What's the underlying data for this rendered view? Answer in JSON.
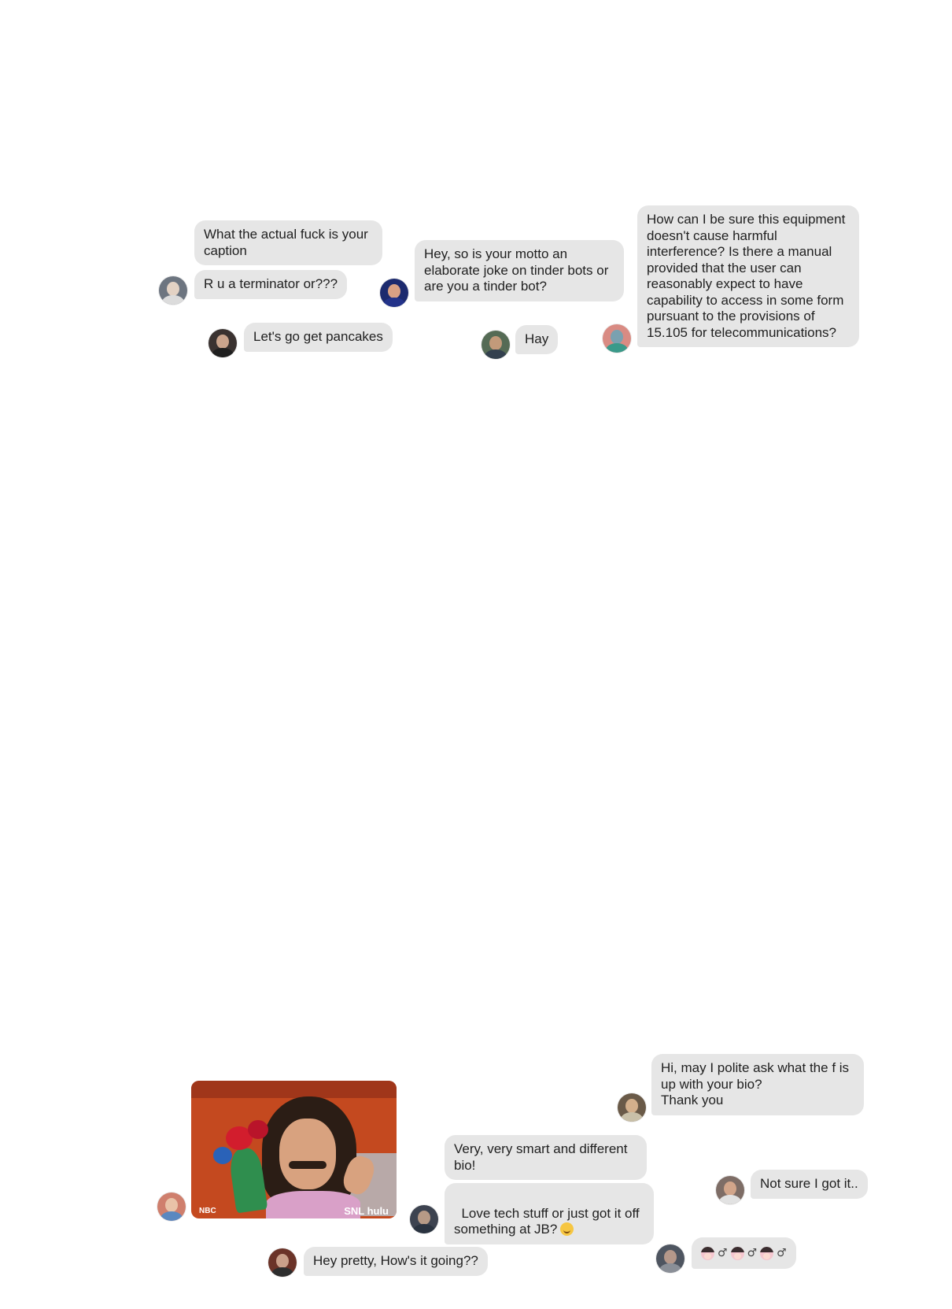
{
  "top_section": {
    "bubble_caption": "What the actual fuck is your caption",
    "bubble_terminator": "R u a terminator or???",
    "bubble_pancakes": "Let's go get pancakes",
    "bubble_motto": "Hey, so is your motto an elaborate joke on tinder bots or are you a tinder bot?",
    "bubble_hay": "Hay",
    "bubble_equipment": "How can I be sure this equipment doesn't cause harmful interference? Is there a manual provided that the user can reasonably expect to have capability to access in some form pursuant to the provisions of 15.105 for telecommunications?"
  },
  "bottom_section": {
    "gif": {
      "watermark_left": "NBC",
      "watermark_right": "SNL hulu"
    },
    "bubble_polite": "Hi, may I polite ask what the f is up with your bio?\nThank you",
    "bubble_smart": "Very, very smart and different bio!",
    "bubble_tech": "Love tech stuff or just got it off something at JB?",
    "bubble_tech_emoji": "smiling-face-emoji",
    "bubble_not_sure": "Not sure I got it..",
    "bubble_pretty": "Hey pretty, How's it going??",
    "emoji_sequence": [
      "woman-face",
      "male-sign",
      "woman-face",
      "male-sign",
      "woman-face",
      "male-sign"
    ],
    "male_sign_glyph": "♂"
  },
  "colors": {
    "bubble_bg": "#e6e6e6",
    "page_bg": "#ffffff",
    "text": "#1f1f1f"
  }
}
